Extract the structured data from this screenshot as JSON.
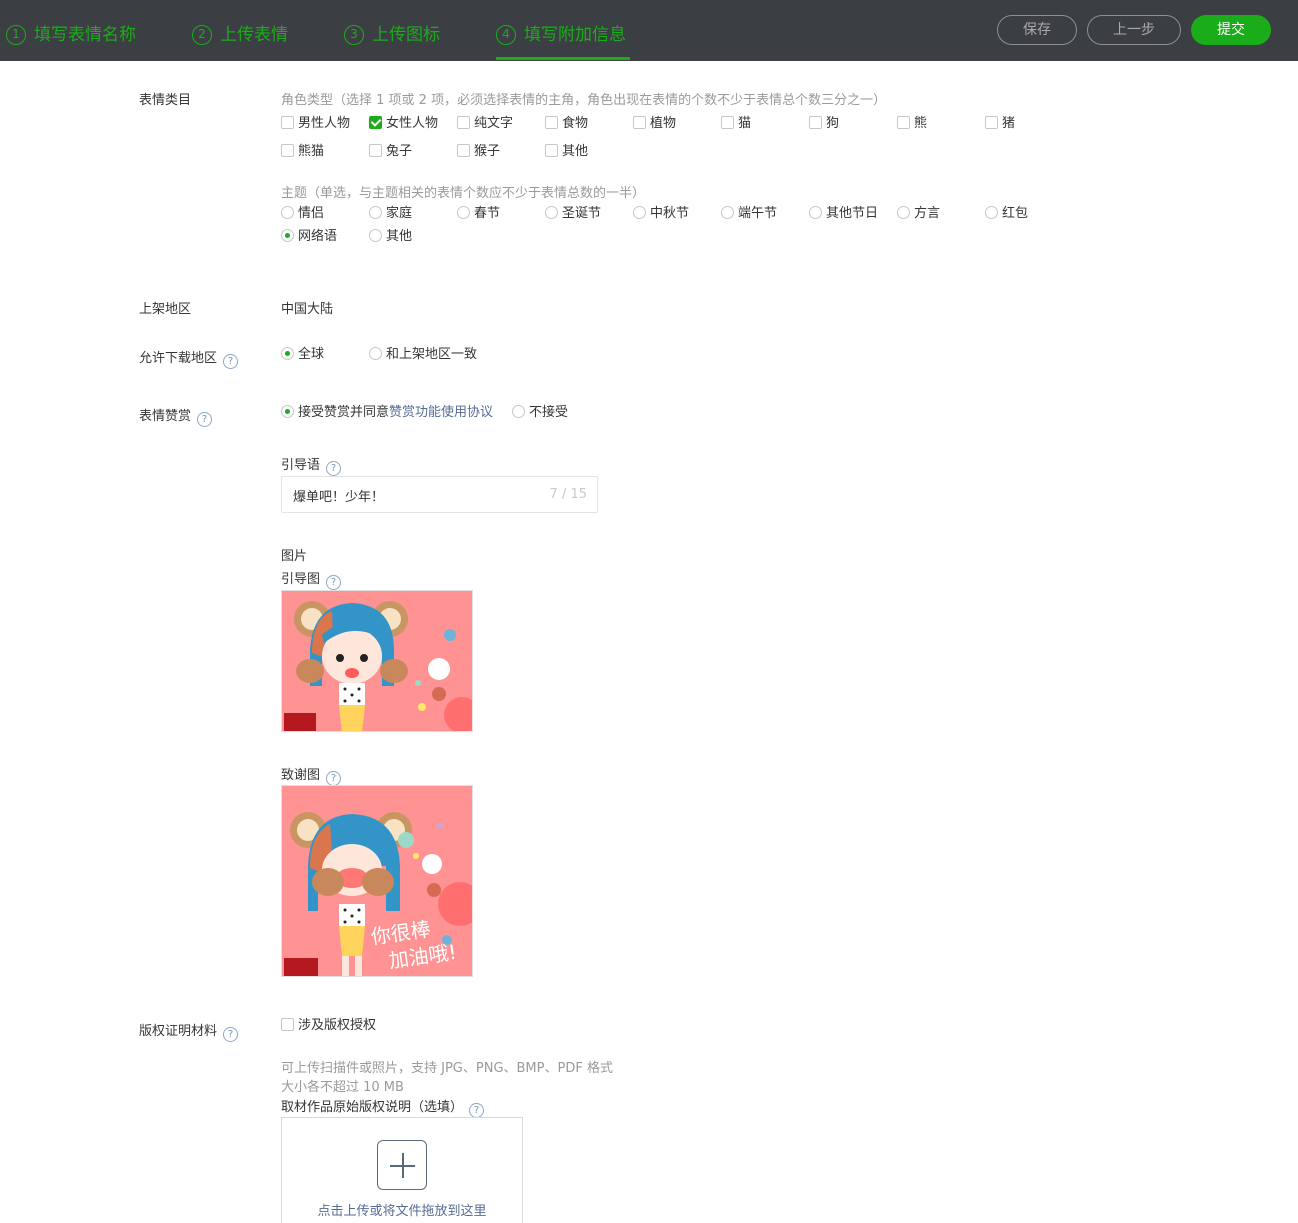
{
  "steps": [
    {
      "num": "1",
      "label": "填写表情名称"
    },
    {
      "num": "2",
      "label": "上传表情"
    },
    {
      "num": "3",
      "label": "上传图标"
    },
    {
      "num": "4",
      "label": "填写附加信息"
    }
  ],
  "actions": {
    "save": "保存",
    "prev": "上一步",
    "submit": "提交"
  },
  "category": {
    "label": "表情类目",
    "role_hint": "角色类型（选择 1 项或 2 项，必须选择表情的主角，角色出现在表情的个数不少于表情总个数三分之一）",
    "roles": [
      {
        "label": "男性人物",
        "checked": false
      },
      {
        "label": "女性人物",
        "checked": true
      },
      {
        "label": "纯文字",
        "checked": false
      },
      {
        "label": "食物",
        "checked": false
      },
      {
        "label": "植物",
        "checked": false
      },
      {
        "label": "猫",
        "checked": false
      },
      {
        "label": "狗",
        "checked": false
      },
      {
        "label": "熊",
        "checked": false
      },
      {
        "label": "猪",
        "checked": false
      },
      {
        "label": "熊猫",
        "checked": false
      },
      {
        "label": "兔子",
        "checked": false
      },
      {
        "label": "猴子",
        "checked": false
      },
      {
        "label": "其他",
        "checked": false
      }
    ],
    "theme_hint": "主题（单选，与主题相关的表情个数应不少于表情总数的一半）",
    "themes": [
      {
        "label": "情侣",
        "checked": false
      },
      {
        "label": "家庭",
        "checked": false
      },
      {
        "label": "春节",
        "checked": false
      },
      {
        "label": "圣诞节",
        "checked": false
      },
      {
        "label": "中秋节",
        "checked": false
      },
      {
        "label": "端午节",
        "checked": false
      },
      {
        "label": "其他节日",
        "checked": false
      },
      {
        "label": "方言",
        "checked": false
      },
      {
        "label": "红包",
        "checked": false
      },
      {
        "label": "网络语",
        "checked": true
      },
      {
        "label": "其他",
        "checked": false
      }
    ]
  },
  "region": {
    "label": "上架地区",
    "value": "中国大陆"
  },
  "download_region": {
    "label": "允许下载地区",
    "options": [
      {
        "label": "全球",
        "checked": true
      },
      {
        "label": "和上架地区一致",
        "checked": false
      }
    ]
  },
  "reward": {
    "label": "表情赞赏",
    "accept_text": "接受赞赏并同意",
    "agreement_link": "赞赏功能使用协议",
    "reject_text": "不接受",
    "accept_checked": true,
    "guide_label": "引导语",
    "guide_value": "爆单吧！少年！",
    "guide_count": "7 / 15",
    "image_label": "图片",
    "guide_image_label": "引导图",
    "thanks_image_label": "致谢图",
    "thanks_text_line1": "你很棒",
    "thanks_text_line2": "加油哦!"
  },
  "copyright": {
    "label": "版权证明材料",
    "checkbox_label": "涉及版权授权",
    "checked": false,
    "hint_line1": "可上传扫描件或照片，支持 JPG、PNG、BMP、PDF 格式",
    "hint_line2": "大小各不超过 10 MB",
    "source_label": "取材作品原始版权说明（选填）",
    "upload_text": "点击上传或将文件拖放到这里"
  },
  "help_symbol": "?",
  "colors": {
    "brand": "#1aad19",
    "topbar": "#3b3e42",
    "link": "#576b95"
  }
}
